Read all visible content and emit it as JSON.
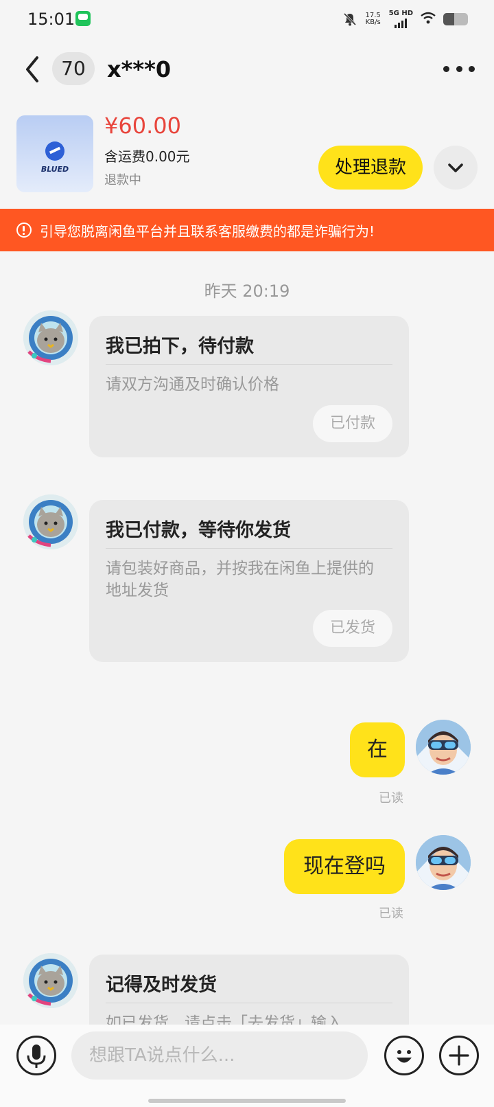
{
  "status_bar": {
    "time": "15:01",
    "speed_value": "17.5",
    "speed_unit": "KB/s",
    "network": "5G HD",
    "battery_level": 0.45
  },
  "header": {
    "back_icon": "chevron-left-icon",
    "unread_count": "70",
    "peer_name": "x***0",
    "more_icon": "more-horizontal-icon"
  },
  "product": {
    "thumb_label": "BLUED",
    "price": "¥60.00",
    "shipping_note": "含运费0.00元",
    "order_status": "退款中",
    "refund_button": "处理退款",
    "expand_icon": "chevron-down-icon"
  },
  "warning": {
    "icon": "alert-circle-icon",
    "text": "引导您脱离闲鱼平台并且联系客服缴费的都是诈骗行为!"
  },
  "chat": {
    "timestamp": "昨天 20:19",
    "messages": [
      {
        "type": "card",
        "title": "我已拍下，待付款",
        "desc": "请双方沟通及时确认价格",
        "button": "已付款"
      },
      {
        "type": "card",
        "title": "我已付款，等待你发货",
        "desc": "请包装好商品，并按我在闲鱼上提供的地址发货",
        "button": "已发货"
      },
      {
        "type": "text",
        "text": "在",
        "read": "已读"
      },
      {
        "type": "text",
        "text": "现在登吗",
        "read": "已读"
      },
      {
        "type": "card",
        "title": "记得及时发货",
        "desc": "如已发货，请点击「去发货」输入"
      }
    ]
  },
  "composer": {
    "mic_icon": "microphone-icon",
    "placeholder": "想跟TA说点什么...",
    "emoji_icon": "emoji-icon",
    "plus_icon": "plus-icon"
  },
  "colors": {
    "accent_yellow": "#ffe21a",
    "price_red": "#e8453c",
    "warning_orange": "#ff5722",
    "background": "#f5f5f5"
  }
}
